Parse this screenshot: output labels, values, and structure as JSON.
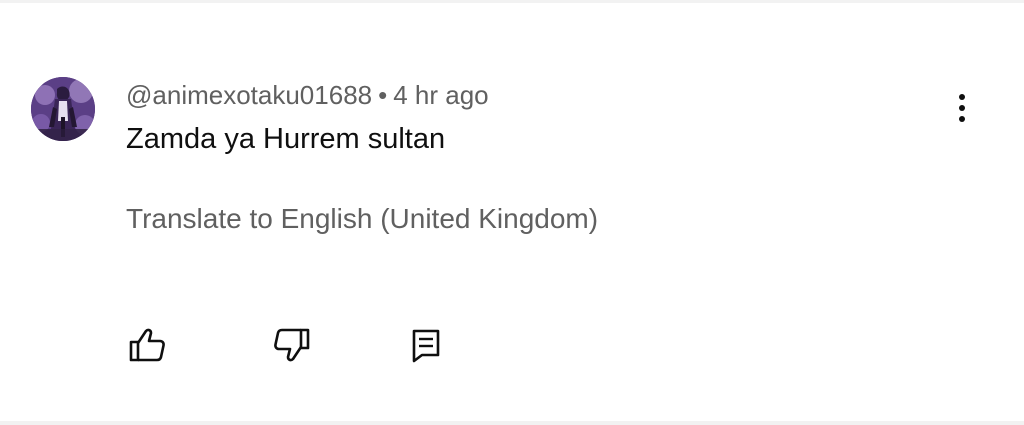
{
  "comment": {
    "author": "@animexotaku01688",
    "separator": "•",
    "time": "4 hr ago",
    "text": "Zamda ya Hurrem sultan",
    "translate_label": "Translate to English (United Kingdom)"
  },
  "icons": {
    "like": "thumbs-up-icon",
    "dislike": "thumbs-down-icon",
    "reply": "reply-comment-icon",
    "menu": "more-vert-icon",
    "avatar": "avatar-image"
  },
  "colors": {
    "primary_text": "#0f0f0f",
    "secondary_text": "#606060",
    "background": "#ffffff"
  }
}
